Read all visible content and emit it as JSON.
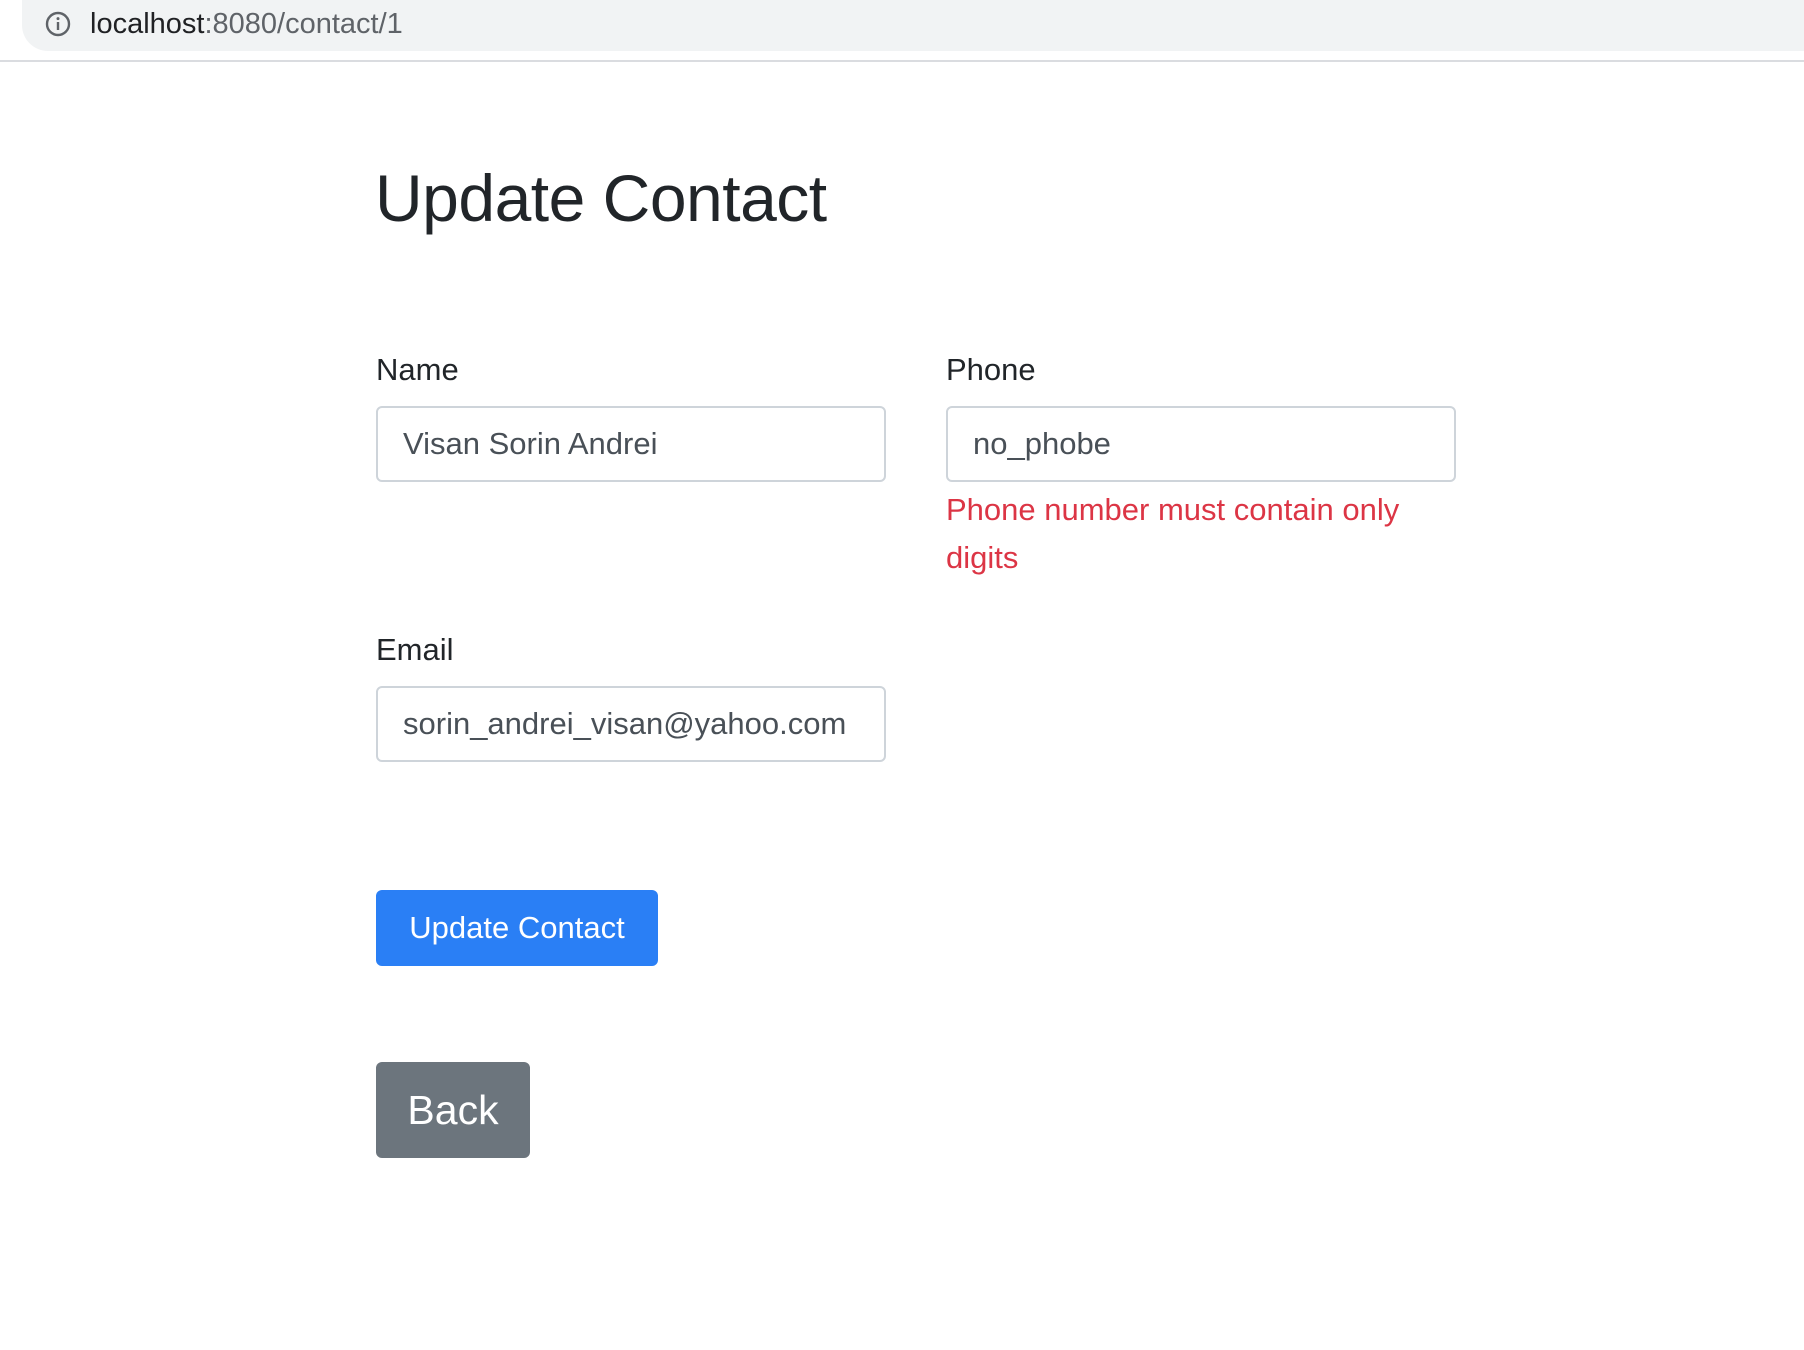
{
  "browser": {
    "url_host": "localhost",
    "url_path": ":8080/contact/1",
    "info_icon": "info-circle-icon"
  },
  "page": {
    "title": "Update Contact"
  },
  "form": {
    "name": {
      "label": "Name",
      "value": "Visan Sorin Andrei"
    },
    "phone": {
      "label": "Phone",
      "value": "no_phobe",
      "error": "Phone number must contain only digits",
      "error_color": "#dc3545"
    },
    "email": {
      "label": "Email",
      "value": "sorin_andrei_visan@yahoo.com"
    },
    "submit_label": "Update Contact",
    "submit_color": "#2a7ff5"
  },
  "actions": {
    "back_label": "Back",
    "back_color": "#6c757d"
  }
}
